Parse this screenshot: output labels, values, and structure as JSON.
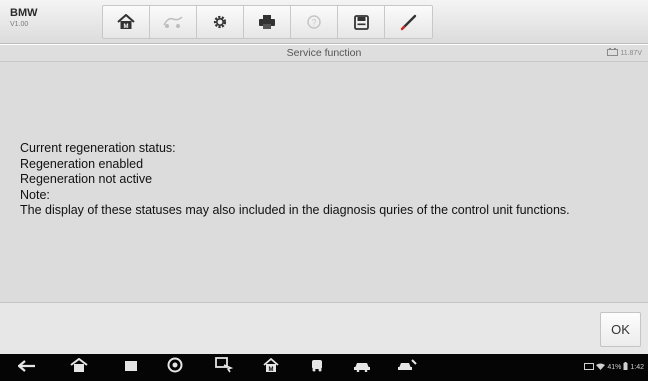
{
  "app": {
    "brand": "BMW",
    "version": "V1.00"
  },
  "toolbar": {
    "buttons": [
      {
        "name": "home",
        "icon": "home-icon"
      },
      {
        "name": "vehicle-swap",
        "icon": "vehicle-swap-icon",
        "disabled": true
      },
      {
        "name": "settings",
        "icon": "gear-icon"
      },
      {
        "name": "print",
        "icon": "printer-icon"
      },
      {
        "name": "help",
        "icon": "help-icon",
        "disabled": true
      },
      {
        "name": "save",
        "icon": "save-icon"
      },
      {
        "name": "data-logging",
        "icon": "pen-icon"
      }
    ]
  },
  "titlebar": {
    "title": "Service function",
    "voltage": "11.87V"
  },
  "message": {
    "lines": [
      "Current regeneration status:",
      "Regeneration enabled",
      "Regeneration not active",
      "Note:",
      "The display of these statuses may also included in the diagnosis quries of the control unit functions."
    ]
  },
  "actions": {
    "ok_label": "OK"
  },
  "status_bar": {
    "battery": "41%",
    "time": "1:42"
  },
  "colors": {
    "background": "#dcdcdc",
    "navbar": "#050505",
    "accent_red": "#c92a1f"
  }
}
